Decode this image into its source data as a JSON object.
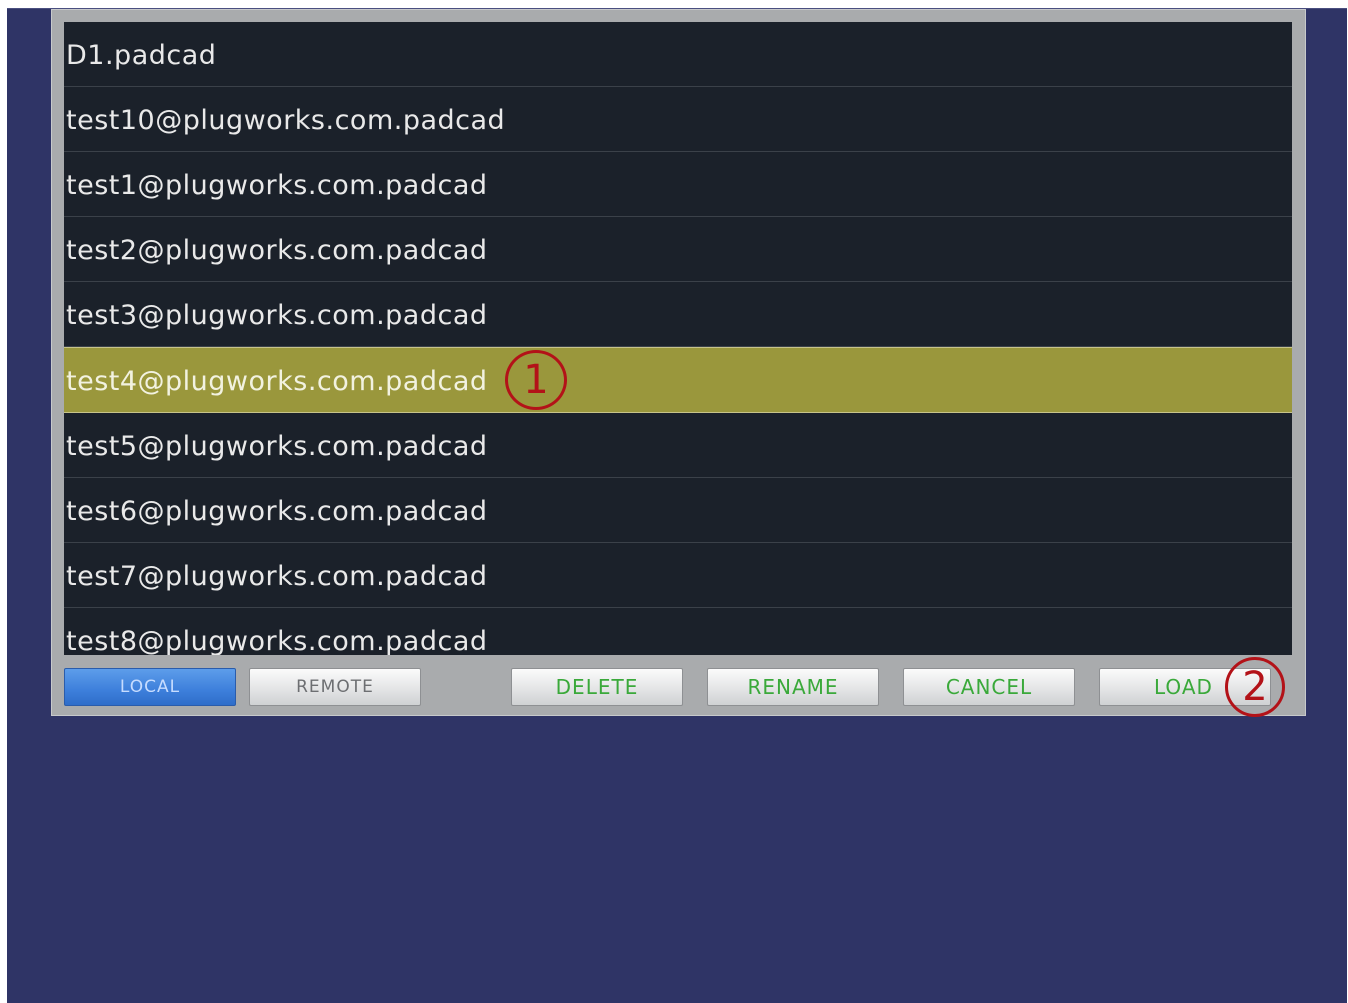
{
  "file_list": {
    "items": [
      {
        "name": "D1.padcad",
        "selected": false
      },
      {
        "name": "test10@plugworks.com.padcad",
        "selected": false
      },
      {
        "name": "test1@plugworks.com.padcad",
        "selected": false
      },
      {
        "name": "test2@plugworks.com.padcad",
        "selected": false
      },
      {
        "name": "test3@plugworks.com.padcad",
        "selected": false
      },
      {
        "name": "test4@plugworks.com.padcad",
        "selected": true
      },
      {
        "name": "test5@plugworks.com.padcad",
        "selected": false
      },
      {
        "name": "test6@plugworks.com.padcad",
        "selected": false
      },
      {
        "name": "test7@plugworks.com.padcad",
        "selected": false
      },
      {
        "name": "test8@plugworks.com.padcad",
        "selected": false
      }
    ],
    "selected_color": "#9a973c"
  },
  "toolbar": {
    "local_label": "LOCAL",
    "remote_label": "REMOTE",
    "delete_label": "DELETE",
    "rename_label": "RENAME",
    "cancel_label": "CANCEL",
    "load_label": "LOAD",
    "active_tab": "LOCAL"
  },
  "annotations": {
    "marker_1": "1",
    "marker_2": "2",
    "marker_color": "#b31218"
  }
}
